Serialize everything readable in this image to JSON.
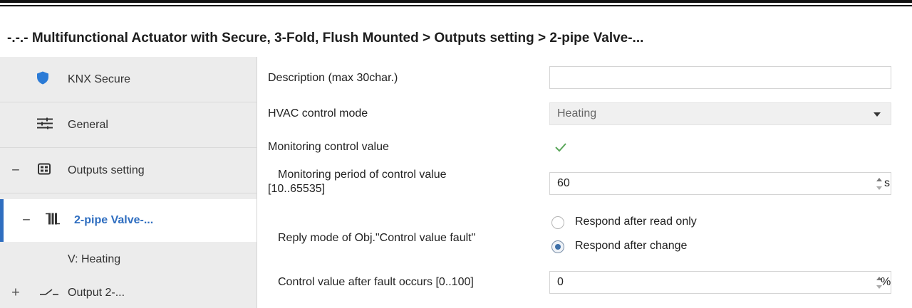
{
  "window": {
    "breadcrumb": "-.-.- Multifunctional Actuator with Secure, 3-Fold, Flush Mounted > Outputs setting > 2-pipe Valve-..."
  },
  "sidebar": {
    "items": [
      {
        "label": "KNX Secure",
        "icon": "shield-icon"
      },
      {
        "label": "General",
        "icon": "sliders-icon"
      },
      {
        "label": "Outputs setting",
        "icon": "grid-icon",
        "toggle": "−"
      },
      {
        "label": "2-pipe Valve-...",
        "icon": "radiator-icon",
        "toggle": "−",
        "selected": true
      },
      {
        "label": "V: Heating"
      },
      {
        "label": "Output 2-...",
        "icon": "switch-icon",
        "toggle": "+"
      }
    ]
  },
  "main": {
    "description": {
      "label": "Description (max 30char.)",
      "value": ""
    },
    "hvac_mode": {
      "label": "HVAC control mode",
      "value": "Heating"
    },
    "monitoring": {
      "label": "Monitoring control value",
      "checked": true
    },
    "period": {
      "label_line1": "Monitoring period of control value",
      "label_line2": "[10..65535]",
      "value": "60",
      "unit": "s"
    },
    "reply_mode": {
      "label": "Reply mode of Obj.\"Control value fault\"",
      "options": [
        "Respond after read only",
        "Respond after change"
      ],
      "selected_index": 1
    },
    "fault_value": {
      "label": "Control value after fault occurs [0..100]",
      "value": "0",
      "unit": "%"
    }
  },
  "colors": {
    "accent": "#2f6ec0",
    "check": "#5aa65a",
    "shield": "#2b7bd6"
  }
}
